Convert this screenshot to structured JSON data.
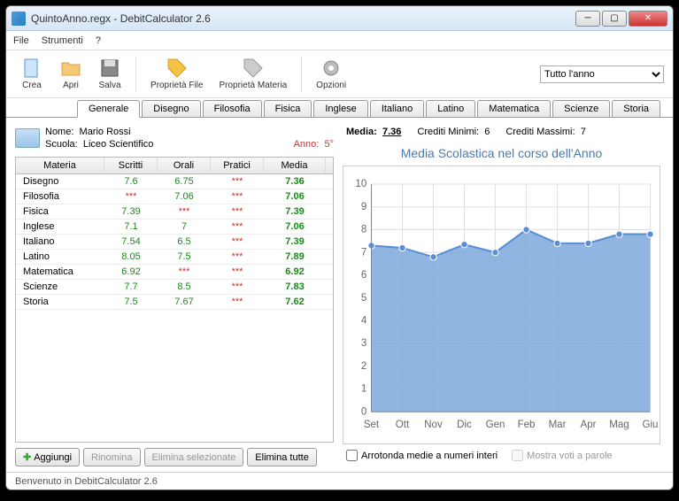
{
  "window": {
    "title": "QuintoAnno.regx - DebitCalculator 2.6"
  },
  "menu": {
    "file": "File",
    "strumenti": "Strumenti",
    "help": "?"
  },
  "toolbar": {
    "crea": "Crea",
    "apri": "Apri",
    "salva": "Salva",
    "propFile": "Proprietà File",
    "propMateria": "Proprietà Materia",
    "opzioni": "Opzioni"
  },
  "period": {
    "selected": "Tutto l'anno"
  },
  "tabs": [
    "Generale",
    "Disegno",
    "Filosofia",
    "Fisica",
    "Inglese",
    "Italiano",
    "Latino",
    "Matematica",
    "Scienze",
    "Storia"
  ],
  "student": {
    "nomeLabel": "Nome:",
    "nome": "Mario Rossi",
    "scuolaLabel": "Scuola:",
    "scuola": "Liceo Scientifico",
    "annoLabel": "Anno:",
    "anno": "5°"
  },
  "grades": {
    "headers": {
      "materia": "Materia",
      "scritti": "Scritti",
      "orali": "Orali",
      "pratici": "Pratici",
      "media": "Media"
    },
    "rows": [
      {
        "materia": "Disegno",
        "scritti": "7.6",
        "orali": "6.75",
        "pratici": "***",
        "media": "7.36",
        "sC": "g",
        "oC": "g",
        "pC": "r",
        "mC": "g b"
      },
      {
        "materia": "Filosofia",
        "scritti": "***",
        "orali": "7.06",
        "pratici": "***",
        "media": "7.06",
        "sC": "r",
        "oC": "g",
        "pC": "r",
        "mC": "g b"
      },
      {
        "materia": "Fisica",
        "scritti": "7.39",
        "orali": "***",
        "pratici": "***",
        "media": "7.39",
        "sC": "g",
        "oC": "r",
        "pC": "r",
        "mC": "g b"
      },
      {
        "materia": "Inglese",
        "scritti": "7.1",
        "orali": "7",
        "pratici": "***",
        "media": "7.06",
        "sC": "g",
        "oC": "g",
        "pC": "r",
        "mC": "g b"
      },
      {
        "materia": "Italiano",
        "scritti": "7.54",
        "orali": "6.5",
        "pratici": "***",
        "media": "7.39",
        "sC": "g",
        "oC": "g",
        "pC": "r",
        "mC": "g b"
      },
      {
        "materia": "Latino",
        "scritti": "8.05",
        "orali": "7.5",
        "pratici": "***",
        "media": "7.89",
        "sC": "g",
        "oC": "g",
        "pC": "r",
        "mC": "g b"
      },
      {
        "materia": "Matematica",
        "scritti": "6.92",
        "orali": "***",
        "pratici": "***",
        "media": "6.92",
        "sC": "g",
        "oC": "r",
        "pC": "r",
        "mC": "g b"
      },
      {
        "materia": "Scienze",
        "scritti": "7.7",
        "orali": "8.5",
        "pratici": "***",
        "media": "7.83",
        "sC": "g",
        "oC": "g",
        "pC": "r",
        "mC": "g b"
      },
      {
        "materia": "Storia",
        "scritti": "7.5",
        "orali": "7.67",
        "pratici": "***",
        "media": "7.62",
        "sC": "g",
        "oC": "g",
        "pC": "r",
        "mC": "g b"
      }
    ]
  },
  "buttons": {
    "aggiungi": "Aggiungi",
    "rinomina": "Rinomina",
    "eliminaSel": "Elimina selezionate",
    "eliminaTutte": "Elimina tutte"
  },
  "stats": {
    "mediaLabel": "Media:",
    "media": "7.36",
    "creditiMinLabel": "Crediti Minimi:",
    "creditiMin": "6",
    "creditiMaxLabel": "Crediti Massimi:",
    "creditiMax": "7"
  },
  "chart_data": {
    "type": "area",
    "title": "Media Scolastica nel corso dell'Anno",
    "categories": [
      "Set",
      "Ott",
      "Nov",
      "Dic",
      "Gen",
      "Feb",
      "Mar",
      "Apr",
      "Mag",
      "Giu"
    ],
    "values": [
      7.3,
      7.2,
      6.8,
      7.35,
      7.0,
      8.0,
      7.4,
      7.4,
      7.8,
      7.8
    ],
    "ylim": [
      0,
      10
    ],
    "yticks": [
      0,
      1,
      2,
      3,
      4,
      5,
      6,
      7,
      8,
      9,
      10
    ],
    "color": "#5a8fd4",
    "fillColor": "#7ea8dc"
  },
  "checks": {
    "arrotonda": "Arrotonda medie a numeri interi",
    "parole": "Mostra voti a parole"
  },
  "status": "Benvenuto in DebitCalculator 2.6"
}
